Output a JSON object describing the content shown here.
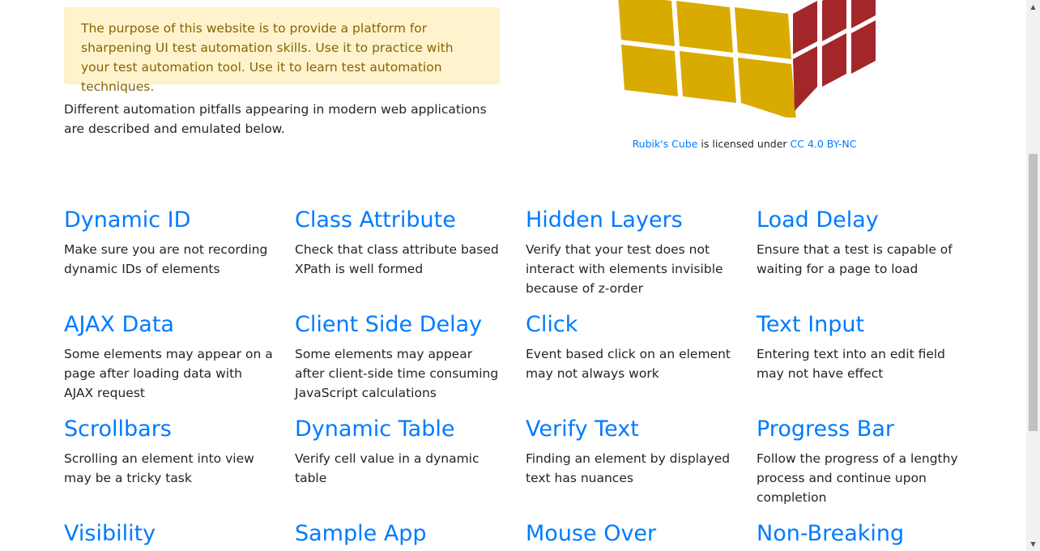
{
  "alert": {
    "text": "The purpose of this website is to provide a platform for sharpening UI test automation skills. Use it to practice with your test automation tool. Use it to learn test automation techniques."
  },
  "intro": {
    "text": "Different automation pitfalls appearing in modern web applications are described and emulated below."
  },
  "credit": {
    "link1": "Rubik's Cube",
    "middle": " is licensed under ",
    "link2": "CC 4.0 BY-NC"
  },
  "cube_colors": {
    "yellow": "#d9ab00",
    "red": "#a3272a",
    "gap": "#ffffff"
  },
  "cards": [
    {
      "title": "Dynamic ID",
      "desc": "Make sure you are not recording dynamic IDs of elements"
    },
    {
      "title": "Class Attribute",
      "desc": "Check that class attribute based XPath is well formed"
    },
    {
      "title": "Hidden Layers",
      "desc": "Verify that your test does not interact with elements invisible because of z-order"
    },
    {
      "title": "Load Delay",
      "desc": "Ensure that a test is capable of waiting for a page to load"
    },
    {
      "title": "AJAX Data",
      "desc": "Some elements may appear on a page after loading data with AJAX request"
    },
    {
      "title": "Client Side Delay",
      "desc": "Some elements may appear after client-side time consuming JavaScript calculations"
    },
    {
      "title": "Click",
      "desc": "Event based click on an element may not always work"
    },
    {
      "title": "Text Input",
      "desc": "Entering text into an edit field may not have effect"
    },
    {
      "title": "Scrollbars",
      "desc": "Scrolling an element into view may be a tricky task"
    },
    {
      "title": "Dynamic Table",
      "desc": "Verify cell value in a dynamic table"
    },
    {
      "title": "Verify Text",
      "desc": "Finding an element by displayed text has nuances"
    },
    {
      "title": "Progress Bar",
      "desc": "Follow the progress of a lengthy process and continue upon completion"
    },
    {
      "title": "Visibility",
      "desc": ""
    },
    {
      "title": "Sample App",
      "desc": ""
    },
    {
      "title": "Mouse Over",
      "desc": ""
    },
    {
      "title": "Non-Breaking",
      "desc": ""
    }
  ]
}
